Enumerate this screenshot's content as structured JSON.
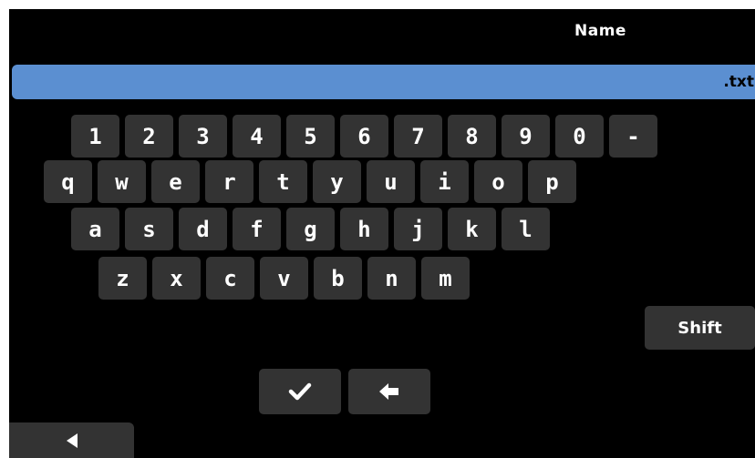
{
  "header": {
    "title": "Name"
  },
  "name_field": {
    "value": ".txt"
  },
  "keyboard": {
    "row1": [
      "1",
      "2",
      "3",
      "4",
      "5",
      "6",
      "7",
      "8",
      "9",
      "0",
      "-"
    ],
    "row2": [
      "q",
      "w",
      "e",
      "r",
      "t",
      "y",
      "u",
      "i",
      "o",
      "p"
    ],
    "row3": [
      "a",
      "s",
      "d",
      "f",
      "g",
      "h",
      "j",
      "k",
      "l"
    ],
    "row4": [
      "z",
      "x",
      "c",
      "v",
      "b",
      "n",
      "m"
    ],
    "shift_label": "Shift"
  },
  "actions": {
    "confirm_icon": "check-icon",
    "backspace_icon": "left-arrow-icon",
    "back_icon": "triangle-left-icon"
  },
  "colors": {
    "background": "#000000",
    "key": "#333333",
    "field": "#5b8fd1",
    "text": "#ffffff"
  }
}
